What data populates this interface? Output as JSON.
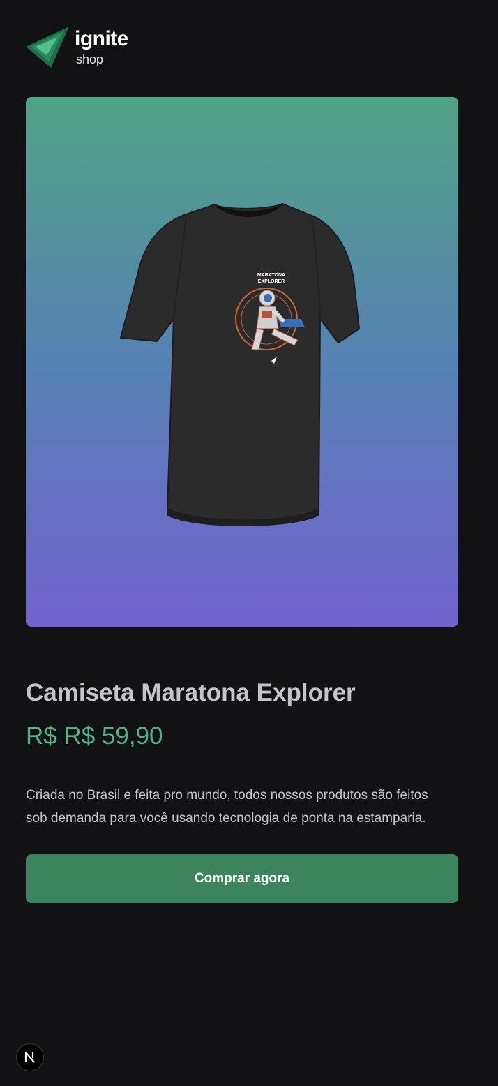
{
  "brand": {
    "name": "ignite",
    "sub": "shop",
    "accent_color": "#00875f",
    "icon": "ignite-logo-icon"
  },
  "product": {
    "image_alt": "Camiseta Maratona Explorer",
    "shirt_print_line1": "MARATONA",
    "shirt_print_line2": "EXPLORER",
    "title": "Camiseta Maratona Explorer",
    "price": "R$ R$ 59,90",
    "description": "Criada no Brasil e feita pro mundo, todos nossos produtos são feitos sob demanda para você usando tecnologia de ponta na estamparia.",
    "buy_label": "Comprar agora",
    "price_color": "#4fb487"
  },
  "devtools": {
    "badge_icon": "nextjs-icon"
  }
}
